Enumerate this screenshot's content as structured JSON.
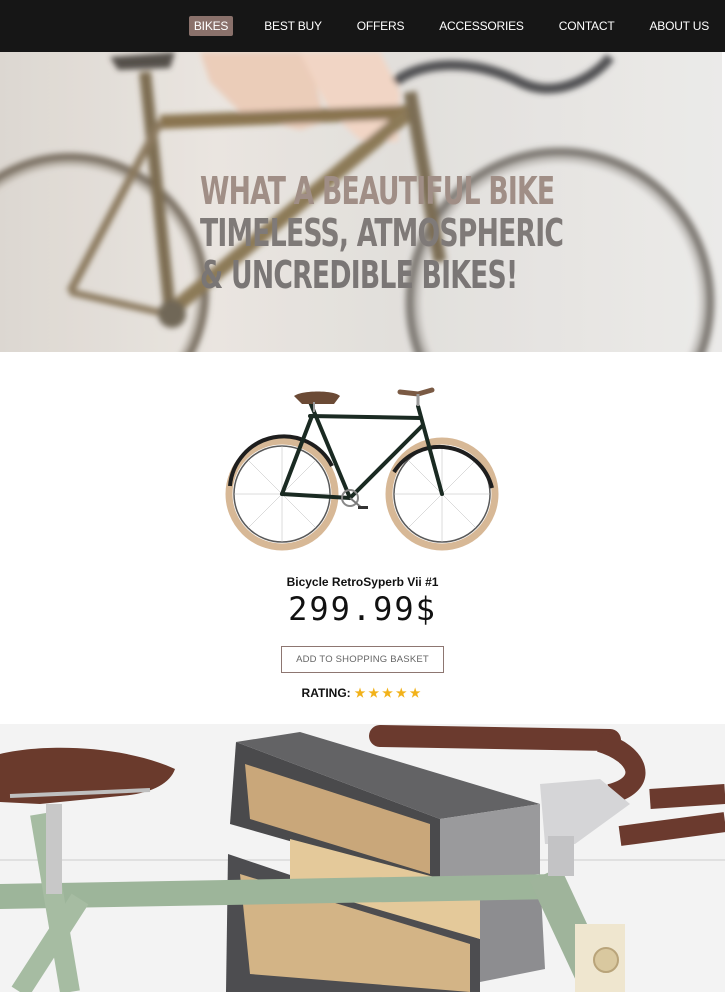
{
  "nav": {
    "items": [
      {
        "label": "BIKES",
        "active": true
      },
      {
        "label": "BEST BUY",
        "active": false
      },
      {
        "label": "OFFERS",
        "active": false
      },
      {
        "label": "ACCESSORIES",
        "active": false
      },
      {
        "label": "CONTACT",
        "active": false
      },
      {
        "label": "ABOUT US",
        "active": false
      }
    ]
  },
  "hero": {
    "line1": "WHAT A BEAUTIFUL BIKE",
    "line2": "TIMELESS, ATMOSPHERIC",
    "line3": "& UNCREDIBLE BIKES!"
  },
  "product": {
    "name": "Bicycle RetroSyperb Vii #1",
    "price": "299.99$",
    "add_button_label": "ADD TO SHOPPING BASKET",
    "rating_label": "RATING:",
    "rating_value": 5,
    "rating_max": 5,
    "stars": "★★★★★"
  },
  "colors": {
    "nav_bg": "#161616",
    "active_nav": "#8a716b",
    "star": "#f2b21a"
  }
}
